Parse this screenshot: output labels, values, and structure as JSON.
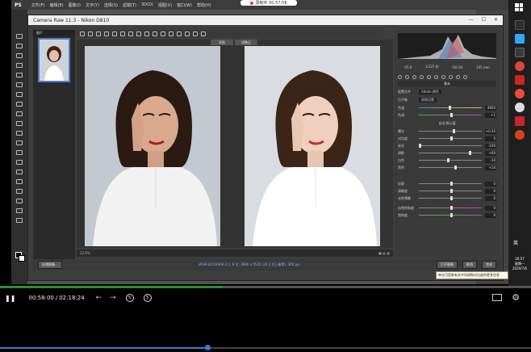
{
  "ps": {
    "app_logo": "PS",
    "menu": [
      "文件(F)",
      "编辑(E)",
      "图像(I)",
      "文字(Y)",
      "选择(S)",
      "滤镜(T)",
      "3D(D)",
      "视图(V)",
      "窗口(W)",
      "帮助(H)"
    ],
    "rec_time": "录制中 00:57:58"
  },
  "camera_raw": {
    "title": "Camera Raw 11.3 - Nikon D810",
    "filmstrip_header": "胶片",
    "view_before": "原图",
    "view_after": "调整后",
    "zoom": "22.6%",
    "bottom_info": "sRGB IEC61966-2.1; 8 位; 3680 x 5520 (20.3 百万像素); 300 ppi",
    "btn_save": "存储图像...",
    "btn_open": "打开图像",
    "btn_cancel": "取消",
    "btn_done": "完成"
  },
  "adjust": {
    "cam_info": [
      "f/5.6",
      "1/125 秒",
      "ISO 64",
      "105 mm"
    ],
    "panel_title": "基本",
    "profile_label": "配置文件",
    "profile_value": "Adobe 颜色",
    "wb_label": "白平衡",
    "wb_value": "原照设置",
    "section_tone": "色调",
    "section_auto": "自动",
    "section_default": "默认值",
    "section_presence": "偏好",
    "rows_top": [
      {
        "label": "色温",
        "value": "4850"
      },
      {
        "label": "色调",
        "value": "+1"
      }
    ],
    "rows_mid": [
      {
        "label": "曝光",
        "value": "+0.35"
      },
      {
        "label": "对比度",
        "value": "0"
      },
      {
        "label": "高光",
        "value": "-100"
      },
      {
        "label": "阴影",
        "value": "+60"
      },
      {
        "label": "白色",
        "value": "-10"
      },
      {
        "label": "黑色",
        "value": "+14"
      }
    ],
    "rows_bot": [
      {
        "label": "纹理",
        "value": "0"
      },
      {
        "label": "清晰度",
        "value": "0"
      },
      {
        "label": "去除薄雾",
        "value": "0"
      },
      {
        "label": "自然饱和度",
        "value": "0"
      },
      {
        "label": "饱和度",
        "value": "0"
      }
    ]
  },
  "tooltip": "单击可获取有关中间调和对比度的更多信息",
  "taskbar": {
    "time": "20:57",
    "day": "星期一",
    "date": "2020/7/6",
    "lang": "英"
  },
  "player": {
    "time_current": "00:58:00",
    "time_separator": "/",
    "time_total": "02:18:24",
    "skip_back": "5",
    "skip_fwd": "5",
    "progress_fraction": 0.42,
    "scrub_fraction": 0.39
  }
}
